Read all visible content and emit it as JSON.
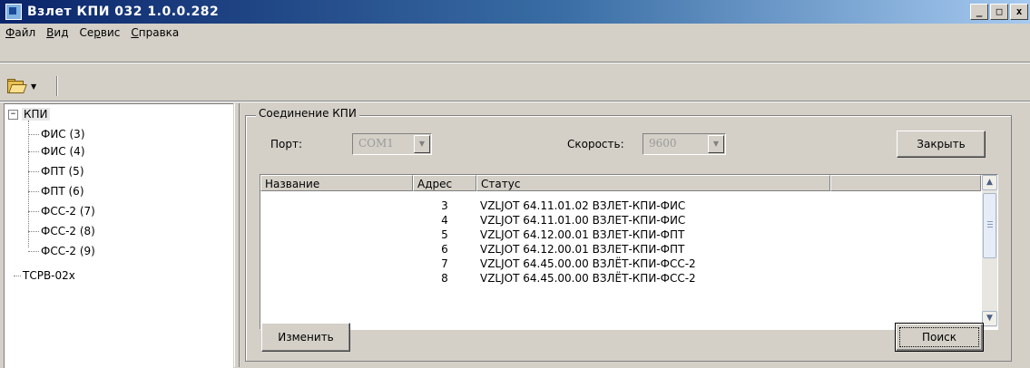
{
  "window": {
    "title": "Взлет КПИ 032  1.0.0.282",
    "min_glyph": "_",
    "max_glyph": "□",
    "close_glyph": "x"
  },
  "menu": {
    "items": [
      {
        "accel": "Ф",
        "rest": "айл"
      },
      {
        "accel": "В",
        "rest": "ид"
      },
      {
        "pre": "Се",
        "accel": "р",
        "rest": "вис"
      },
      {
        "accel": "С",
        "rest": "правка"
      }
    ]
  },
  "toolbar": {
    "open_icon": "folder-open-icon",
    "dropdown_glyph": "▼"
  },
  "tree": {
    "root": {
      "label": "КПИ",
      "expander": "−"
    },
    "children": [
      "ФИС (3)",
      "ФИС (4)",
      "ФПТ (5)",
      "ФПТ (6)",
      "ФСС-2 (7)",
      "ФСС-2 (8)",
      "ФСС-2 (9)"
    ],
    "root2": {
      "label": "ТСРВ-02х"
    }
  },
  "connection": {
    "group_title": "Соединение КПИ",
    "port_label": "Порт:",
    "port_value": "COM1",
    "speed_label": "Скорость:",
    "speed_value": "9600",
    "close_button": "Закрыть",
    "edit_button": "Изменить",
    "search_button": "Поиск"
  },
  "table": {
    "columns": [
      "Название",
      "Адрес",
      "Статус",
      ""
    ],
    "rows": [
      {
        "name": "",
        "address": "3",
        "status": "VZLJOT 64.11.01.02 ВЗЛЕТ-КПИ-ФИС"
      },
      {
        "name": "",
        "address": "4",
        "status": "VZLJOT 64.11.01.00 ВЗЛЕТ-КПИ-ФИС"
      },
      {
        "name": "",
        "address": "5",
        "status": "VZLJOT 64.12.00.01 ВЗЛЕТ-КПИ-ФПТ"
      },
      {
        "name": "",
        "address": "6",
        "status": "VZLJOT 64.12.00.01 ВЗЛЕТ-КПИ-ФПТ"
      },
      {
        "name": "",
        "address": "7",
        "status": "VZLJOT 64.45.00.00 ВЗЛЁТ-КПИ-ФСС-2"
      },
      {
        "name": "",
        "address": "8",
        "status": "VZLJOT 64.45.00.00 ВЗЛЁТ-КПИ-ФСС-2"
      }
    ],
    "scroll_up": "▲",
    "scroll_down": "▼"
  }
}
